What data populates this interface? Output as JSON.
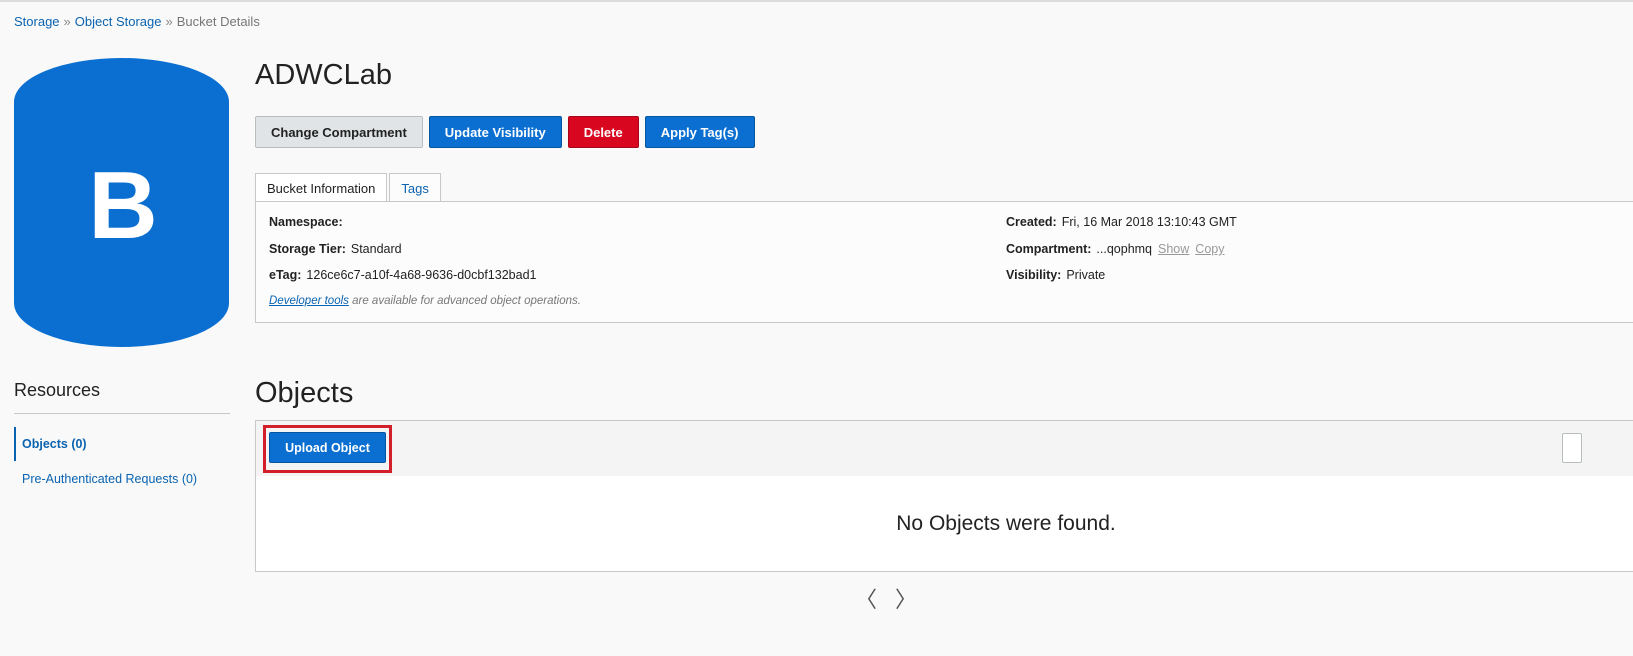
{
  "breadcrumb": {
    "items": [
      "Storage",
      "Object Storage",
      "Bucket Details"
    ],
    "separator": "»"
  },
  "bucket": {
    "icon_letter": "B",
    "icon_color": "#0a6fd1",
    "title": "ADWCLab"
  },
  "actions": {
    "change_compartment": "Change Compartment",
    "update_visibility": "Update Visibility",
    "delete": "Delete",
    "apply_tags": "Apply Tag(s)"
  },
  "tabs": {
    "bucket_information": "Bucket Information",
    "tags": "Tags"
  },
  "info": {
    "namespace_label": "Namespace:",
    "namespace_value": "",
    "storage_tier_label": "Storage Tier:",
    "storage_tier_value": "Standard",
    "etag_label": "eTag:",
    "etag_value": "126ce6c7-a10f-4a68-9636-d0cbf132bad1",
    "created_label": "Created:",
    "created_value": "Fri, 16 Mar 2018 13:10:43 GMT",
    "compartment_label": "Compartment:",
    "compartment_value": "...qophmq",
    "compartment_show": "Show",
    "compartment_copy": "Copy",
    "visibility_label": "Visibility:",
    "visibility_value": "Private",
    "dev_tools_link": "Developer tools",
    "dev_tools_text": " are available for advanced object operations."
  },
  "resources": {
    "heading": "Resources",
    "items": [
      {
        "label": "Objects (0)",
        "active": true
      },
      {
        "label": "Pre-Authenticated Requests (0)",
        "active": false
      }
    ]
  },
  "objects": {
    "title": "Objects",
    "upload_label": "Upload Object",
    "empty_message": "No Objects were found."
  },
  "pager": {
    "prev": "〈",
    "next": "〉"
  },
  "colors": {
    "accent": "#0a6fd1",
    "danger": "#d8061e",
    "highlight": "#d31f2a"
  }
}
